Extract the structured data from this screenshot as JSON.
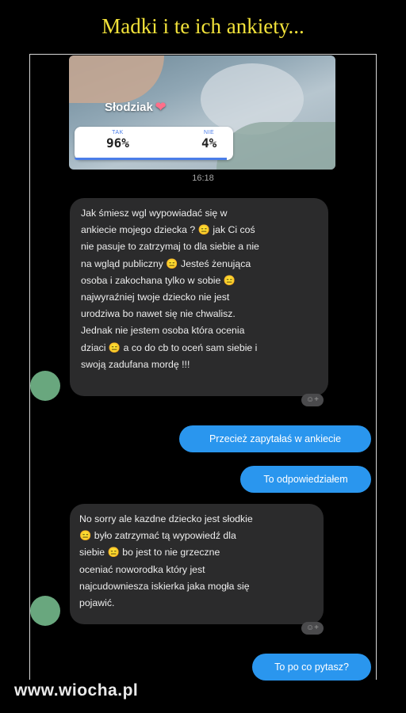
{
  "page": {
    "title": "Madki i te ich ankiety..."
  },
  "story": {
    "sticker": "Słodziak",
    "sticker_emoji": "❤",
    "poll": {
      "yes_label": "TAK",
      "yes_pct": "96%",
      "no_label": "NIE",
      "no_pct": "4%",
      "yes_fraction": 0.96
    }
  },
  "timestamp": "16:18",
  "messages": [
    {
      "id": "in1",
      "direction": "incoming",
      "text": "Jak śmiesz wgl wypowiadać się w\nankiecie mojego dziecka ? 😑 jak Ci coś\nnie pasuje to zatrzymaj to dla siebie a nie\nna wgląd publiczny 😑 Jesteś żenująca\nosoba i zakochana tylko w sobie 😑\nnajwyraźniej twoje dziecko nie jest\nurodziwa bo nawet się nie chwalisz.\nJednak nie jestem osoba która ocenia\ndziaci 😑 a co do cb to oceń sam siebie i\nswoją zadufana mordę !!!"
    },
    {
      "id": "out1",
      "direction": "outgoing",
      "text": "Przecież zapytałaś w ankiecie"
    },
    {
      "id": "out2",
      "direction": "outgoing",
      "text": "To odpowiedziałem"
    },
    {
      "id": "in2",
      "direction": "incoming",
      "text": "No sorry ale kazdne dziecko jest słodkie\n😑 było zatrzymać tą wypowiedź dla\nsiebie 😑 bo jest to nie grzeczne\noceniać noworodka który jest\nnajcudowniesza iskierka jaka mogła się\npojawić."
    },
    {
      "id": "out3",
      "direction": "outgoing",
      "text": "To po co pytasz?"
    }
  ],
  "reaction_icon": "☺+",
  "watermark": "www.wiocha.pl",
  "colors": {
    "title": "#f2e23a",
    "incoming_bubble": "#2b2b2c",
    "outgoing_bubble": "#2a96ee",
    "avatar": "#69a77e",
    "poll_accent": "#4a7de8"
  }
}
